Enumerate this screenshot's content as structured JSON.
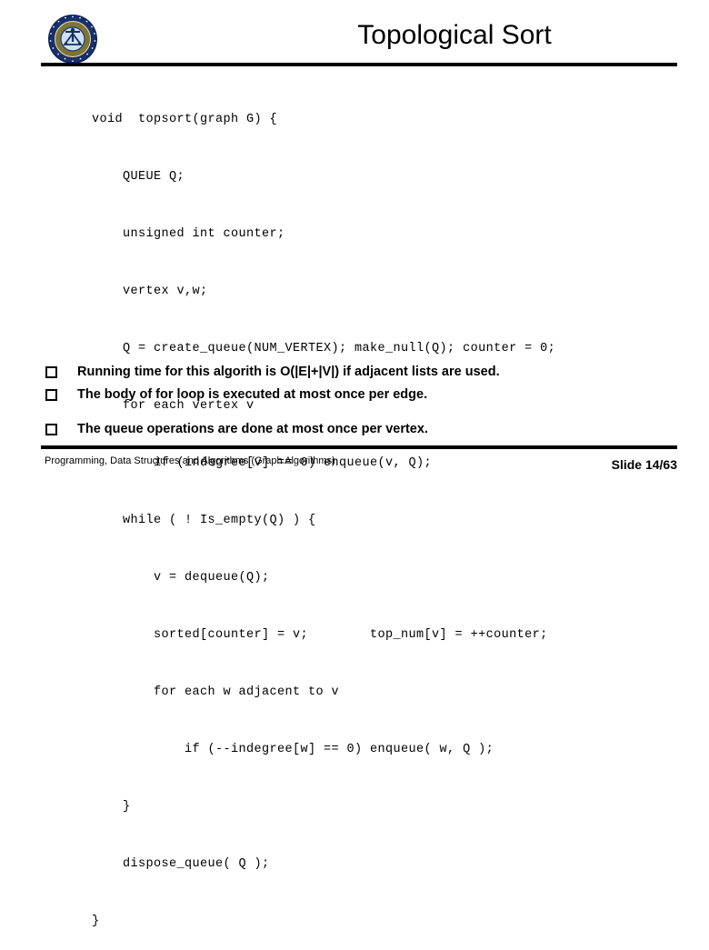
{
  "slide": {
    "title": "Topological Sort",
    "logo_name": "university-seal-logo",
    "accent_rule_color": "#000000"
  },
  "code": {
    "language": "c",
    "lines": [
      "void  topsort(graph G) {",
      "    QUEUE Q;",
      "    unsigned int counter;",
      "    vertex v,w;",
      "    Q = create_queue(NUM_VERTEX); make_null(Q); counter = 0;",
      "    for each vertex v",
      "        if (indegree[v] == 0) enqueue(v, Q);",
      "    while ( ! Is_empty(Q) ) {",
      "        v = dequeue(Q);",
      "        sorted[counter] = v;        top_num[v] = ++counter;",
      "        for each w adjacent to v",
      "            if (--indegree[w] == 0) enqueue( w, Q );",
      "    }",
      "    dispose_queue( Q );",
      "}"
    ]
  },
  "bullets": {
    "marker_glyph": "q",
    "marker_name": "hollow-square-bullet",
    "items": [
      {
        "text": "Running time for this algorith is O(|E|+|V|) if adjacent lists are used.",
        "spaced": false
      },
      {
        "text": "The body of for loop is executed at most once per edge.",
        "spaced": false
      },
      {
        "text": "The queue operations are done at most once per vertex.",
        "spaced": true
      }
    ]
  },
  "footer": {
    "course": "Programming, Data Structures and Algorithms (Graph Algorithms)",
    "slide_number": "Slide 14/63"
  }
}
